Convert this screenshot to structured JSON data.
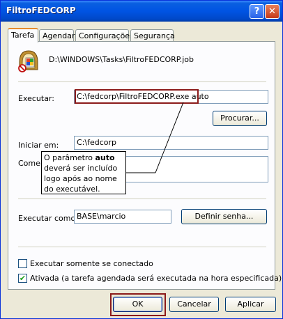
{
  "window": {
    "title": "FiltroFEDCORP"
  },
  "titlebar": {
    "help": "?",
    "close": "✕"
  },
  "tabs": [
    "Tarefa",
    "Agendar",
    "Configurações",
    "Segurança"
  ],
  "task": {
    "path": "D:\\WINDOWS\\Tasks\\FiltroFEDCORP.job",
    "executar_label": "Executar:",
    "executar_value": "C:\\fedcorp\\FiltroFEDCORP.exe auto",
    "procurar_button": "Procurar...",
    "iniciar_label": "Iniciar em:",
    "iniciar_value": "C:\\fedcorp",
    "comentario_label": "Coment",
    "comentario_value": "",
    "executar_como_label": "Executar como:",
    "executar_como_value": "BASE\\marcio",
    "definir_senha_button": "Definir senha...",
    "somente_conectado_label": "Executar somente se  conectado",
    "somente_conectado_checked": false,
    "ativada_label": "Ativada (a tarefa agendada será executada na hora especificada)",
    "ativada_checked": true
  },
  "callout": {
    "line1_pre": "O parâmetro ",
    "line1_bold": "auto",
    "line2": "deverá ser incluído",
    "line3": "logo após ao nome",
    "line4": "do executável."
  },
  "footer": {
    "ok": "OK",
    "cancel": "Cancelar",
    "apply": "Aplicar"
  },
  "colors": {
    "titlebar": "#0054e3",
    "highlight_border": "#8b1a1a",
    "tab_accent": "#e68b2c"
  }
}
